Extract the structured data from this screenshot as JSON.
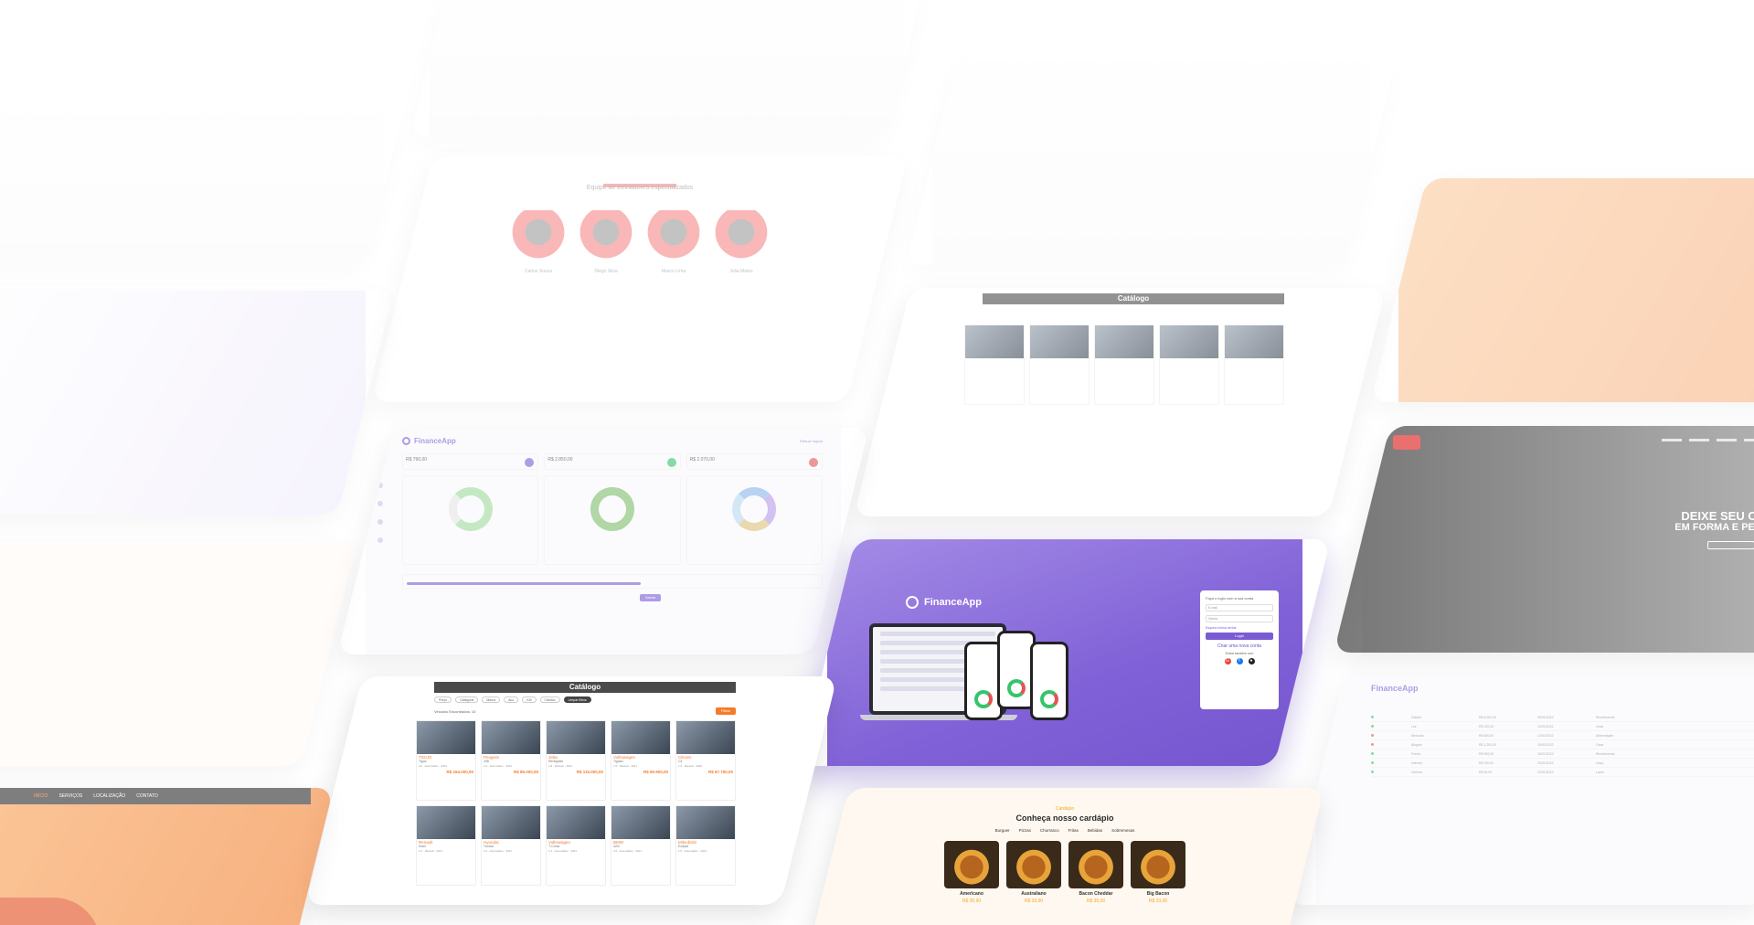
{
  "finance_login": {
    "brand": "FinanceApp",
    "login_title": "Faça o login com a sua conta",
    "email_placeholder": "E-mail",
    "password_placeholder": "Senha",
    "forgot": "Esqueci minha senha",
    "login_button": "Login",
    "create_account": "Criar uma nova conta",
    "or_text": "Entrar também com"
  },
  "dashboard": {
    "brand": "FinanceApp",
    "logout": "Efetuar logout",
    "stats": [
      "R$ 790,00",
      "R$ 2.850,00",
      "R$ 2.070,00"
    ],
    "button": "Salvar"
  },
  "catalog": {
    "title": "Catálogo",
    "filters": [
      "Preço",
      "Categoria",
      "Marca",
      "Ano",
      "KM",
      "Câmbio"
    ],
    "clear_button": "Limpar filtros",
    "filter_button": "Filtrar",
    "found": "Veículos Encontrados: 10",
    "cars": [
      {
        "name": "TIGUO",
        "model": "Tiguo",
        "spec": "2.0 · Automático · 2021",
        "price": "R$ 164.000,00"
      },
      {
        "name": "Peugeot",
        "model": "208",
        "spec": "1.6 · Automático · 2021",
        "price": "R$ 85.000,00"
      },
      {
        "name": "Jetta",
        "model": "Renegade",
        "spec": "1.8 · Manual · 2021",
        "price": "R$ 115.000,00"
      },
      {
        "name": "Volkswagen",
        "model": "Tiguan",
        "spec": "1.6 · Manual · 2021",
        "price": "R$ 90.900,00"
      },
      {
        "name": "Citroen",
        "model": "C4",
        "spec": "1.6 · Manual · 2020",
        "price": "R$ 67.750,00"
      },
      {
        "name": "Renault",
        "model": "Kwid",
        "spec": "1.0 · Manual · 2021",
        "price": ""
      },
      {
        "name": "Hyundai",
        "model": "Tucson",
        "spec": "1.6 · Automático · 2021",
        "price": ""
      },
      {
        "name": "Volkswagen",
        "model": "T-Cross",
        "spec": "1.4 · Automático · 2021",
        "price": ""
      },
      {
        "name": "BMW",
        "model": "320i",
        "spec": "2.0 · Automático · 2021",
        "price": ""
      },
      {
        "name": "Mitsubishi",
        "model": "Eclipse",
        "spec": "1.5 · Automático · 2021",
        "price": ""
      }
    ]
  },
  "menu": {
    "kicker": "Cardápio",
    "heading": "Conheça nosso cardápio",
    "tabs": [
      "Burguer",
      "Pizzas",
      "Churrasco",
      "Fritas",
      "Bebidas",
      "Sobremesas"
    ],
    "items": [
      {
        "name": "Americano",
        "price": "R$ 30,90"
      },
      {
        "name": "Australiano",
        "price": "R$ 33,90"
      },
      {
        "name": "Bacon Cheddar",
        "price": "R$ 35,00"
      },
      {
        "name": "Big Bacon",
        "price": "R$ 33,00"
      }
    ]
  },
  "gym": {
    "headline1": "DEIXE SEU CORPO",
    "headline2": "EM FORMA E PERFEITO"
  },
  "orange_site": {
    "nav": [
      "INÍCIO",
      "SERVIÇOS",
      "LOCALIZAÇÃO",
      "CONTATO"
    ]
  },
  "admin": {
    "brand": "FinanceApp",
    "rows": [
      {
        "name": "Salário",
        "value": "R$ 4.000,00",
        "date": "05/01/2022",
        "cat": "Recebimento",
        "color": "#35c46a"
      },
      {
        "name": "Luz",
        "value": "R$ 120,00",
        "date": "10/01/2022",
        "cat": "Casa",
        "color": "#35c46a"
      },
      {
        "name": "Mercado",
        "value": "R$ 600,00",
        "date": "12/01/2022",
        "cat": "Alimentação",
        "color": "#e25555"
      },
      {
        "name": "Aluguel",
        "value": "R$ 1.200,00",
        "date": "15/01/2022",
        "cat": "Casa",
        "color": "#e25555"
      },
      {
        "name": "Freela",
        "value": "R$ 900,00",
        "date": "18/01/2022",
        "cat": "Recebimento",
        "color": "#35c46a"
      },
      {
        "name": "Internet",
        "value": "R$ 100,00",
        "date": "20/01/2022",
        "cat": "Casa",
        "color": "#35c46a"
      },
      {
        "name": "Cinema",
        "value": "R$ 50,00",
        "date": "22/01/2022",
        "cat": "Lazer",
        "color": "#35c46a"
      }
    ]
  },
  "team": {
    "heading": "Equipe de treinadores especializados",
    "people": [
      "Carlos Souza",
      "Diego Silva",
      "Marco Lima",
      "Julia Matos"
    ]
  }
}
